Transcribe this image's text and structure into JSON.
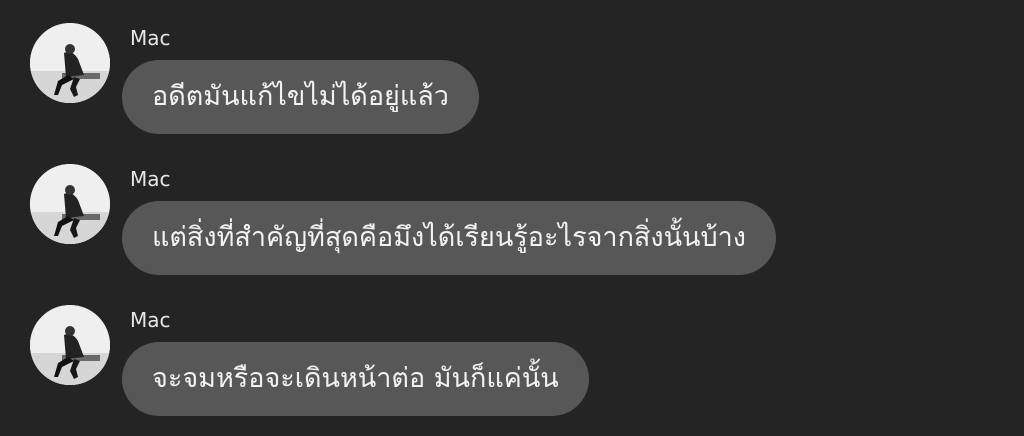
{
  "conversation": {
    "messages": [
      {
        "sender": "Mac",
        "text": "อดีตมันแก้ไขไม่ได้อยู่แล้ว"
      },
      {
        "sender": "Mac",
        "text": "แต่สิ่งที่สำคัญที่สุดคือมึงได้เรียนรู้อะไรจากสิ่งนั้นบ้าง"
      },
      {
        "sender": "Mac",
        "text": "จะจมหรือจะเดินหน้าต่อ มันก็แค่นั้น"
      }
    ]
  },
  "colors": {
    "background": "#242424",
    "bubble": "#575757",
    "text": "#f2f2f2"
  }
}
